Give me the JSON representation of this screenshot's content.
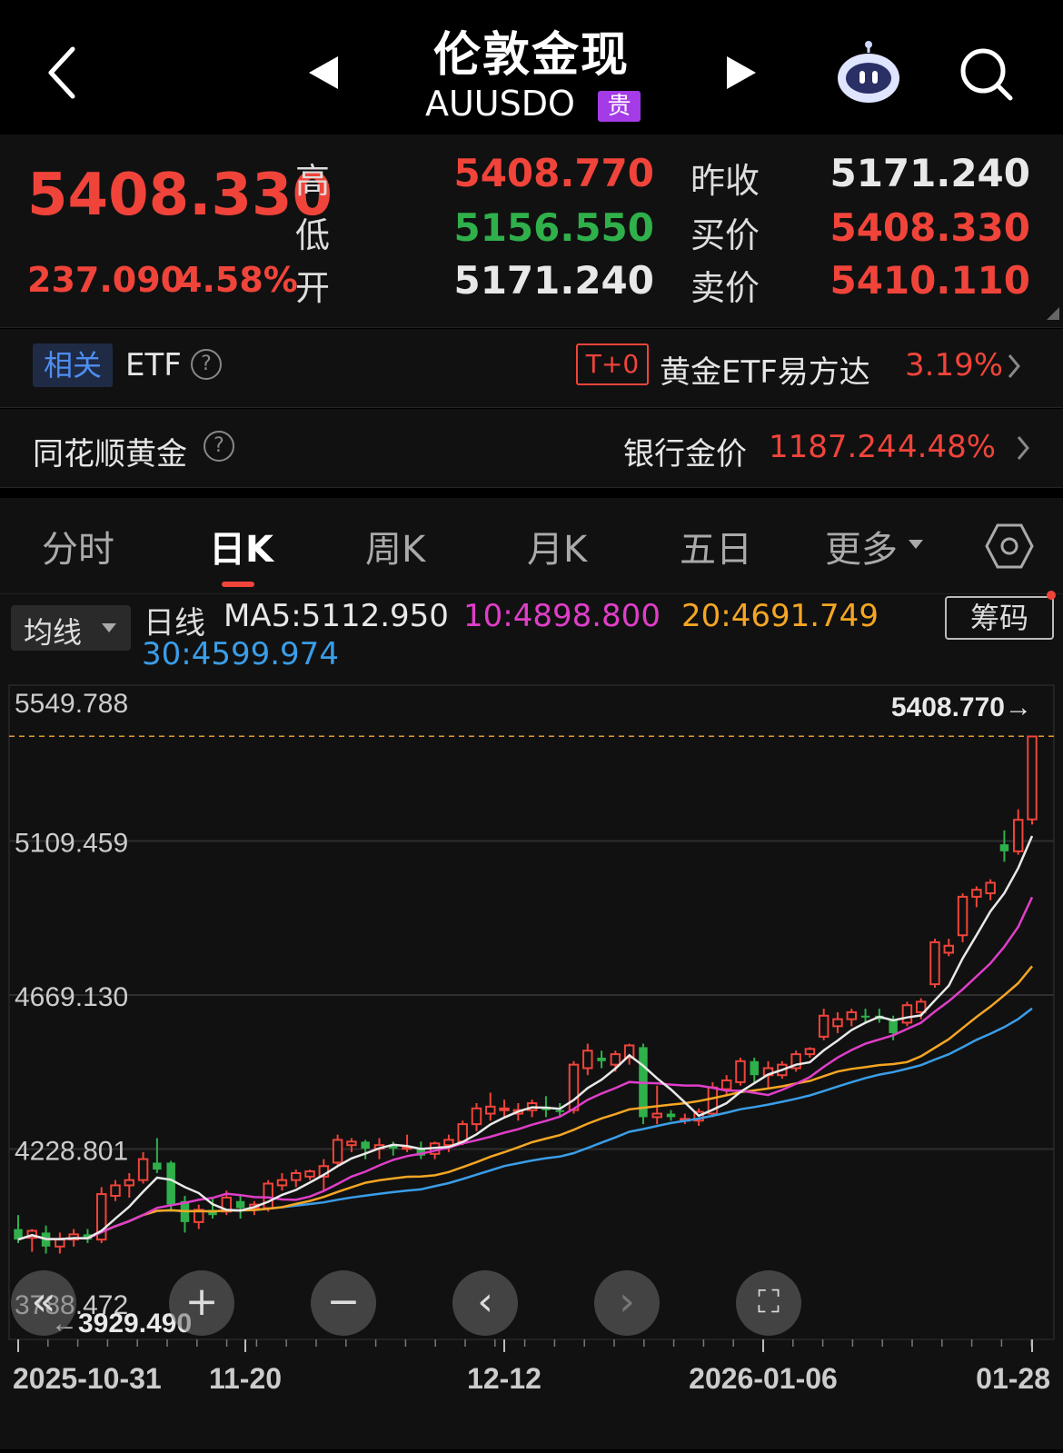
{
  "header": {
    "title": "伦敦金现",
    "symbol": "AUUSDO",
    "badge": "贵"
  },
  "quote": {
    "last": "5408.330",
    "change": "237.090",
    "change_pct": "4.58%",
    "high_label": "高",
    "low_label": "低",
    "open_label": "开",
    "high": "5408.770",
    "low": "5156.550",
    "open": "5171.240",
    "prev_close_label": "昨收",
    "bid_label": "买价",
    "ask_label": "卖价",
    "prev_close": "5171.240",
    "bid": "5408.330",
    "ask": "5410.110"
  },
  "etf_row": {
    "tag": "相关",
    "label": "ETF",
    "t0": "T+0",
    "name": "黄金ETF易方达",
    "pct": "3.19%"
  },
  "gold_row": {
    "label": "同花顺黄金",
    "bank_label": "银行金价",
    "bank_price": "1187.24",
    "bank_pct": "4.48%"
  },
  "tabs": [
    "分时",
    "日K",
    "周K",
    "月K",
    "五日",
    "更多"
  ],
  "ma_row": {
    "select": "均线",
    "daily": "日线",
    "ma5": "MA5:5112.950",
    "ma10": "10:4898.800",
    "ma20": "20:4691.749",
    "ma30": "30:4599.974",
    "chips_button": "筹码"
  },
  "colors": {
    "up": "#f0443a",
    "down": "#2fb04a",
    "ma5": "#e8e8e8",
    "ma10": "#e03ec8",
    "ma20": "#f5a623",
    "ma30": "#3a9ee8"
  },
  "chart_data": {
    "type": "candlestick",
    "y_ticks": [
      "5549.788",
      "5109.459",
      "4669.130",
      "4228.801",
      "3788.472"
    ],
    "ylim": [
      3788.472,
      5549.788
    ],
    "x_ticks": [
      "2025-10-31",
      "11-20",
      "12-12",
      "2026-01-06",
      "01-28"
    ],
    "max_label": "5408.770→",
    "min_label": "←3929.490",
    "candles": [
      {
        "o": 4000,
        "h": 4040,
        "l": 3960,
        "c": 3970
      },
      {
        "o": 3975,
        "h": 4000,
        "l": 3935,
        "c": 3995
      },
      {
        "o": 3990,
        "h": 4010,
        "l": 3930,
        "c": 3950
      },
      {
        "o": 3950,
        "h": 3990,
        "l": 3930,
        "c": 3970
      },
      {
        "o": 3970,
        "h": 4000,
        "l": 3950,
        "c": 3985
      },
      {
        "o": 3985,
        "h": 4000,
        "l": 3960,
        "c": 3970
      },
      {
        "o": 3970,
        "h": 4120,
        "l": 3960,
        "c": 4100
      },
      {
        "o": 4095,
        "h": 4140,
        "l": 4080,
        "c": 4125
      },
      {
        "o": 4125,
        "h": 4160,
        "l": 4090,
        "c": 4140
      },
      {
        "o": 4140,
        "h": 4220,
        "l": 4130,
        "c": 4200
      },
      {
        "o": 4190,
        "h": 4260,
        "l": 4160,
        "c": 4170
      },
      {
        "o": 4190,
        "h": 4195,
        "l": 4050,
        "c": 4070
      },
      {
        "o": 4080,
        "h": 4095,
        "l": 3990,
        "c": 4020
      },
      {
        "o": 4020,
        "h": 4070,
        "l": 4000,
        "c": 4055
      },
      {
        "o": 4055,
        "h": 4090,
        "l": 4030,
        "c": 4040
      },
      {
        "o": 4050,
        "h": 4110,
        "l": 4040,
        "c": 4090
      },
      {
        "o": 4080,
        "h": 4100,
        "l": 4030,
        "c": 4060
      },
      {
        "o": 4060,
        "h": 4080,
        "l": 4040,
        "c": 4070
      },
      {
        "o": 4060,
        "h": 4140,
        "l": 4050,
        "c": 4130
      },
      {
        "o": 4125,
        "h": 4160,
        "l": 4110,
        "c": 4140
      },
      {
        "o": 4140,
        "h": 4170,
        "l": 4120,
        "c": 4160
      },
      {
        "o": 4150,
        "h": 4170,
        "l": 4140,
        "c": 4165
      },
      {
        "o": 4150,
        "h": 4200,
        "l": 4110,
        "c": 4180
      },
      {
        "o": 4190,
        "h": 4270,
        "l": 4180,
        "c": 4255
      },
      {
        "o": 4240,
        "h": 4260,
        "l": 4220,
        "c": 4250
      },
      {
        "o": 4250,
        "h": 4255,
        "l": 4200,
        "c": 4230
      },
      {
        "o": 4230,
        "h": 4260,
        "l": 4200,
        "c": 4240
      },
      {
        "o": 4240,
        "h": 4250,
        "l": 4210,
        "c": 4230
      },
      {
        "o": 4230,
        "h": 4270,
        "l": 4220,
        "c": 4235
      },
      {
        "o": 4230,
        "h": 4250,
        "l": 4200,
        "c": 4210
      },
      {
        "o": 4215,
        "h": 4250,
        "l": 4200,
        "c": 4245
      },
      {
        "o": 4240,
        "h": 4270,
        "l": 4220,
        "c": 4255
      },
      {
        "o": 4250,
        "h": 4310,
        "l": 4240,
        "c": 4300
      },
      {
        "o": 4300,
        "h": 4360,
        "l": 4280,
        "c": 4345
      },
      {
        "o": 4330,
        "h": 4390,
        "l": 4310,
        "c": 4350
      },
      {
        "o": 4340,
        "h": 4370,
        "l": 4320,
        "c": 4345
      },
      {
        "o": 4330,
        "h": 4360,
        "l": 4310,
        "c": 4340
      },
      {
        "o": 4340,
        "h": 4370,
        "l": 4320,
        "c": 4360
      },
      {
        "o": 4350,
        "h": 4380,
        "l": 4320,
        "c": 4340
      },
      {
        "o": 4340,
        "h": 4360,
        "l": 4320,
        "c": 4335
      },
      {
        "o": 4340,
        "h": 4480,
        "l": 4330,
        "c": 4470
      },
      {
        "o": 4460,
        "h": 4530,
        "l": 4440,
        "c": 4510
      },
      {
        "o": 4490,
        "h": 4510,
        "l": 4460,
        "c": 4480
      },
      {
        "o": 4470,
        "h": 4510,
        "l": 4450,
        "c": 4500
      },
      {
        "o": 4490,
        "h": 4530,
        "l": 4470,
        "c": 4525
      },
      {
        "o": 4520,
        "h": 4530,
        "l": 4300,
        "c": 4320
      },
      {
        "o": 4320,
        "h": 4410,
        "l": 4300,
        "c": 4330
      },
      {
        "o": 4330,
        "h": 4340,
        "l": 4310,
        "c": 4320
      },
      {
        "o": 4310,
        "h": 4330,
        "l": 4300,
        "c": 4315
      },
      {
        "o": 4310,
        "h": 4345,
        "l": 4295,
        "c": 4335
      },
      {
        "o": 4330,
        "h": 4420,
        "l": 4320,
        "c": 4405
      },
      {
        "o": 4400,
        "h": 4440,
        "l": 4380,
        "c": 4425
      },
      {
        "o": 4420,
        "h": 4490,
        "l": 4410,
        "c": 4480
      },
      {
        "o": 4480,
        "h": 4490,
        "l": 4420,
        "c": 4440
      },
      {
        "o": 4440,
        "h": 4480,
        "l": 4400,
        "c": 4460
      },
      {
        "o": 4440,
        "h": 4480,
        "l": 4430,
        "c": 4470
      },
      {
        "o": 4460,
        "h": 4510,
        "l": 4450,
        "c": 4500
      },
      {
        "o": 4500,
        "h": 4520,
        "l": 4490,
        "c": 4515
      },
      {
        "o": 4550,
        "h": 4630,
        "l": 4540,
        "c": 4610
      },
      {
        "o": 4580,
        "h": 4620,
        "l": 4560,
        "c": 4600
      },
      {
        "o": 4600,
        "h": 4630,
        "l": 4580,
        "c": 4620
      },
      {
        "o": 4610,
        "h": 4630,
        "l": 4590,
        "c": 4605
      },
      {
        "o": 4610,
        "h": 4630,
        "l": 4590,
        "c": 4600
      },
      {
        "o": 4600,
        "h": 4610,
        "l": 4540,
        "c": 4560
      },
      {
        "o": 4590,
        "h": 4650,
        "l": 4580,
        "c": 4640
      },
      {
        "o": 4620,
        "h": 4660,
        "l": 4600,
        "c": 4650
      },
      {
        "o": 4700,
        "h": 4830,
        "l": 4690,
        "c": 4820
      },
      {
        "o": 4790,
        "h": 4830,
        "l": 4780,
        "c": 4810
      },
      {
        "o": 4840,
        "h": 4960,
        "l": 4820,
        "c": 4950
      },
      {
        "o": 4950,
        "h": 4980,
        "l": 4920,
        "c": 4970
      },
      {
        "o": 4960,
        "h": 5000,
        "l": 4940,
        "c": 4990
      },
      {
        "o": 5100,
        "h": 5140,
        "l": 5050,
        "c": 5080
      },
      {
        "o": 5080,
        "h": 5200,
        "l": 5070,
        "c": 5170
      },
      {
        "o": 5171.24,
        "h": 5408.77,
        "l": 5156.55,
        "c": 5408.33
      }
    ]
  }
}
